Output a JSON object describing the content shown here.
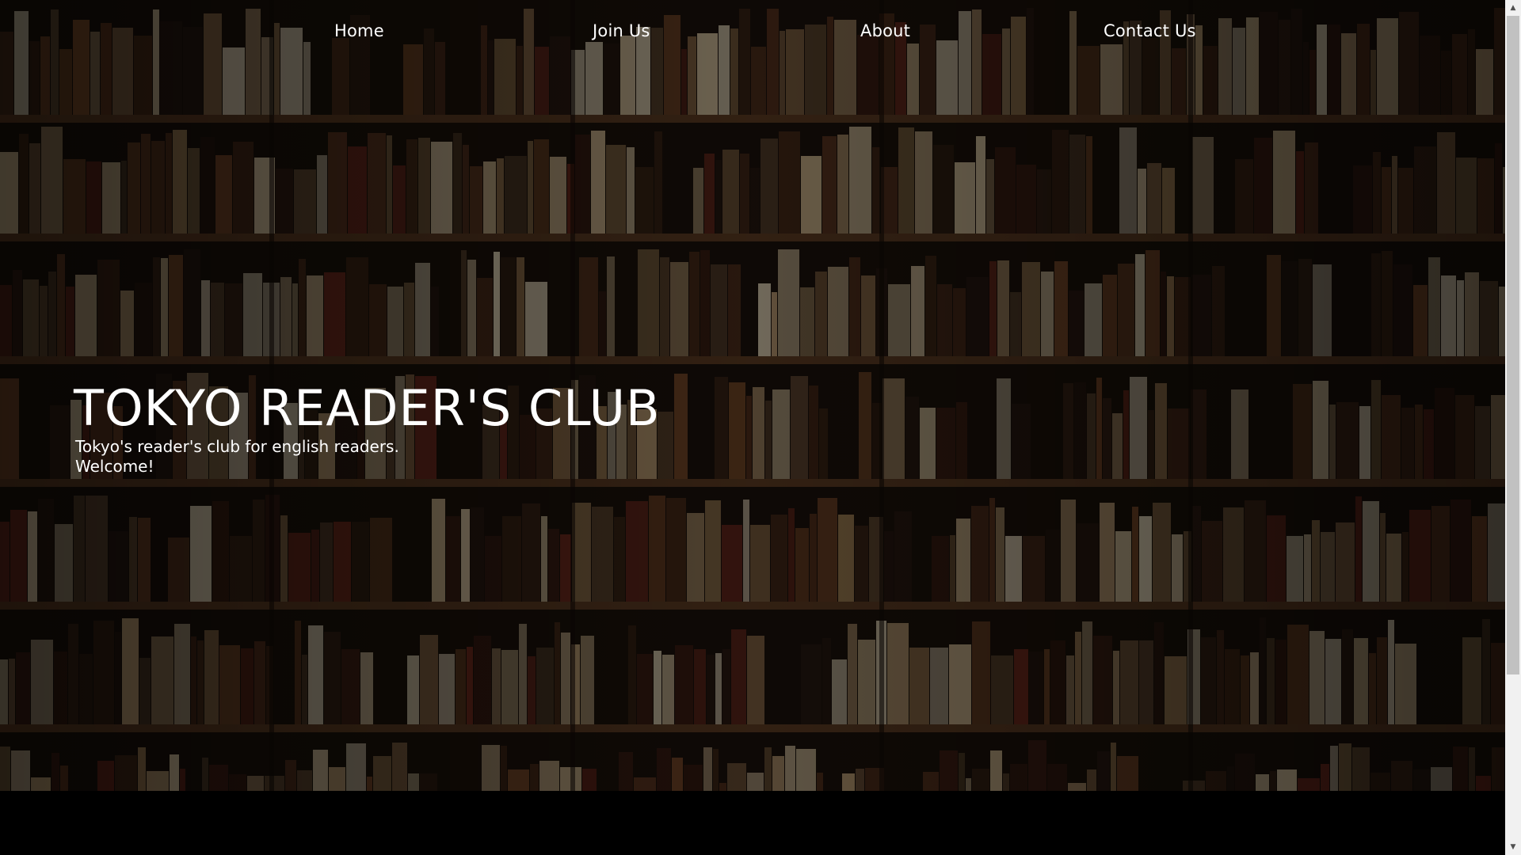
{
  "nav": {
    "items": [
      {
        "label": "Home"
      },
      {
        "label": "Join Us"
      },
      {
        "label": "About"
      },
      {
        "label": "Contact Us"
      }
    ]
  },
  "hero": {
    "title": "TOKYO READER'S CLUB",
    "subtitle_line1": "Tokyo's reader's club for english readers.",
    "subtitle_line2": "Welcome!",
    "background": "bookshelf-photo"
  },
  "colors": {
    "text": "#ffffff",
    "page_background": "#000000",
    "shelf_wood": "#5a3a22"
  },
  "scrollbar": {
    "up_icon": "scroll-up-arrow-icon",
    "down_icon": "scroll-down-arrow-icon"
  }
}
